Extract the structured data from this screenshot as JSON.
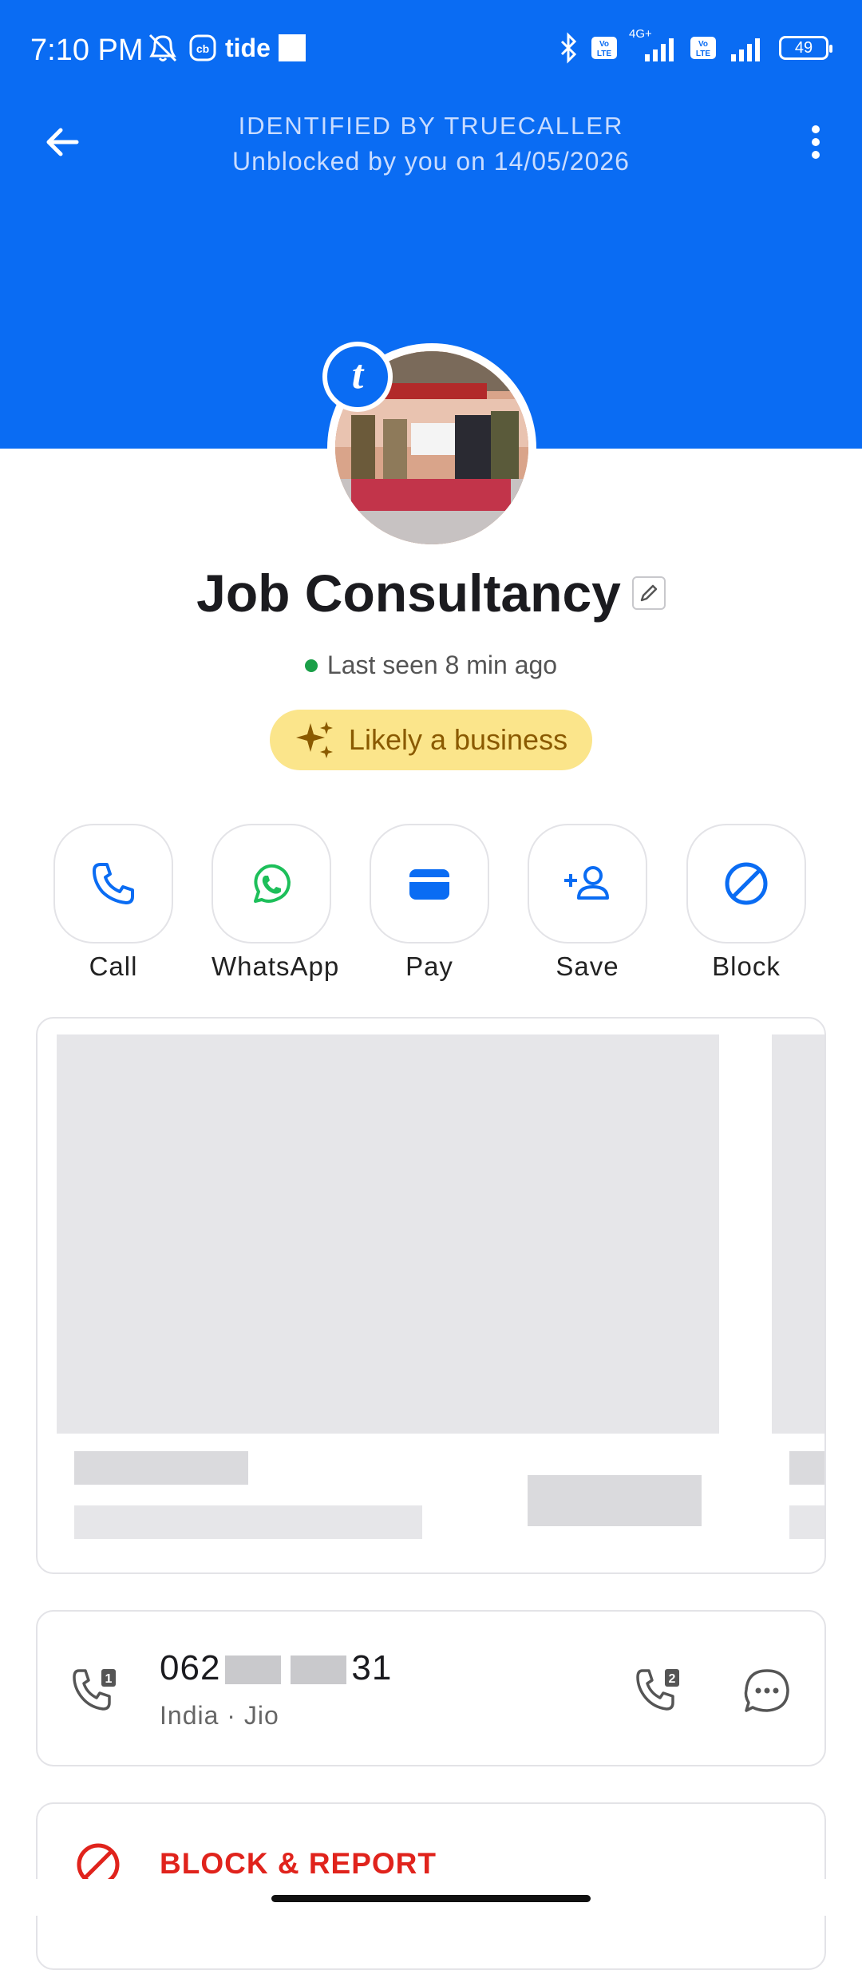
{
  "status_bar": {
    "time": "7:10 PM",
    "app_label": "tide",
    "battery": "49",
    "network_label": "4G+"
  },
  "header": {
    "identified_text": "IDENTIFIED BY TRUECALLER",
    "unblocked_text": "Unblocked by you on 14/05/2026",
    "bg_color": "#0a6cf3"
  },
  "profile": {
    "name": "Job Consultancy",
    "last_seen": "Last seen 8 min ago",
    "business_tag": "Likely a business",
    "badge_letter": "t"
  },
  "actions": [
    {
      "label": "Call",
      "icon": "phone-icon"
    },
    {
      "label": "WhatsApp",
      "icon": "whatsapp-icon"
    },
    {
      "label": "Pay",
      "icon": "wallet-icon"
    },
    {
      "label": "Save",
      "icon": "add-contact-icon"
    },
    {
      "label": "Block",
      "icon": "block-icon"
    }
  ],
  "phone_card": {
    "number_prefix": "062",
    "number_suffix": "31",
    "sub": "India · Jio",
    "sim1_badge": "1",
    "sim2_badge": "2"
  },
  "block_card": {
    "label": "BLOCK & REPORT"
  }
}
